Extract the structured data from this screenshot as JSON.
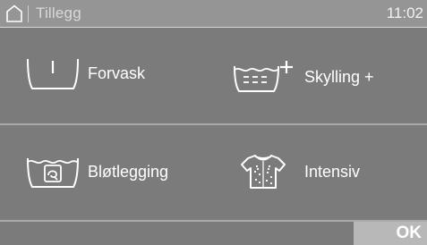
{
  "statusbar": {
    "home_icon": "home-icon",
    "title": "Tillegg",
    "clock": "11:02"
  },
  "options": [
    {
      "label": "Forvask",
      "icon": "prewash-tub-icon"
    },
    {
      "label": "Skylling +",
      "icon": "extra-rinse-icon"
    },
    {
      "label": "Bløtlegging",
      "icon": "soak-tub-icon"
    },
    {
      "label": "Intensiv",
      "icon": "intensive-shirt-icon"
    }
  ],
  "footer": {
    "ok_label": "OK"
  },
  "colors": {
    "background": "#7b7b7b",
    "statusbar": "#959595",
    "ok_button": "#b8b8b8",
    "text": "#ffffff"
  }
}
